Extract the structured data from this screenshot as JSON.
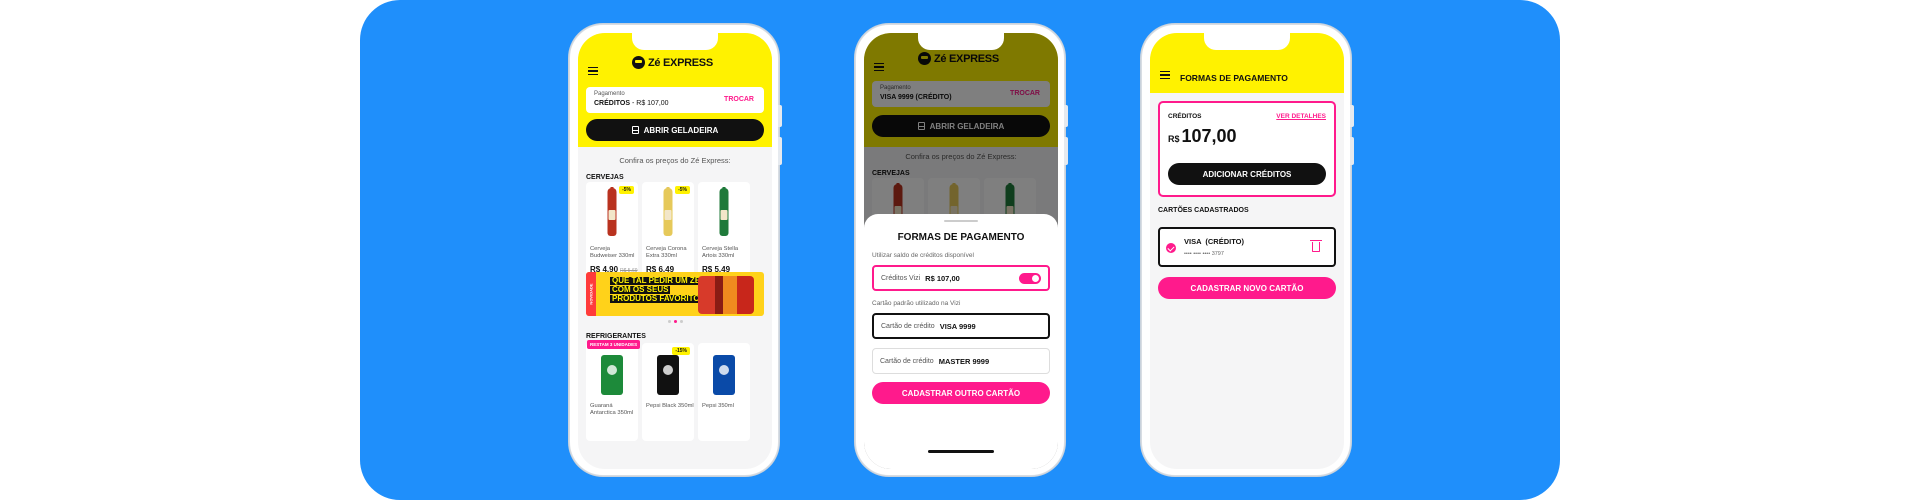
{
  "phone1": {
    "logo_text": "Zé EXPRESS",
    "payment_label": "Pagamento",
    "payment_value": "CRÉDITOS",
    "payment_amount": " - R$ 107,00",
    "change_label": "TROCAR",
    "open_fridge": "ABRIR GELADEIRA",
    "confira": "Confira os preços do Zé Express:",
    "beers_title": "CERVEJAS",
    "beers": [
      {
        "name": "Cerveja Budweiser 330ml",
        "price": "R$ 4,90",
        "old": "R$ 5,69",
        "badge": "-5%"
      },
      {
        "name": "Cerveja Corona Extra 330ml",
        "price": "R$ 6,49",
        "badge": "-5%"
      },
      {
        "name": "Cerveja Stella Artois 330ml",
        "price": "R$ 5,49"
      }
    ],
    "banner": {
      "strip": "NOVIDADE",
      "line1": "QUE TAL PEDIR UM ZÉ",
      "line2": "COM OS SEUS",
      "line3": "PRODUTOS FAVORITOS?"
    },
    "soft_title": "REFRIGERANTES",
    "softs": [
      {
        "name": "Guaraná Antarctica 350ml",
        "badge": "RESTAM 3 UNIDADES"
      },
      {
        "name": "Pepsi Black 350ml",
        "badge": "-15%"
      },
      {
        "name": "Pepsi 350ml"
      }
    ]
  },
  "phone2": {
    "payment_label": "Pagamento",
    "payment_value": "VISA 9999 (CRÉDITO)",
    "change_label": "TROCAR",
    "open_fridge": "ABRIR GELADEIRA",
    "confira": "Confira os preços do Zé Express:",
    "beers_title": "CERVEJAS",
    "sheet_title": "FORMAS DE PAGAMENTO",
    "credit_sub": "Utilizar saldo de créditos disponível",
    "credit_label": "Créditos Vizi",
    "credit_value": "R$ 107,00",
    "card_sub": "Cartão padrão utilizado na Vizi",
    "card1_label": "Cartão de crédito",
    "card1_value": "VISA 9999",
    "card2_label": "Cartão de crédito",
    "card2_value": "MASTER 9999",
    "add_card": "CADASTRAR OUTRO CARTÃO"
  },
  "phone3": {
    "title": "FORMAS DE PAGAMENTO",
    "credits_label": "CRÉDITOS",
    "details_link": "VER DETALHES",
    "currency": "R$",
    "amount": "107,00",
    "add_credits": "ADICIONAR CRÉDITOS",
    "cards_title": "CARTÕES CADASTRADOS",
    "card_name": "VISA  (CRÉDITO)",
    "card_number": "•••• •••• •••• 3797",
    "register_card": "CADASTRAR NOVO CARTÃO"
  }
}
